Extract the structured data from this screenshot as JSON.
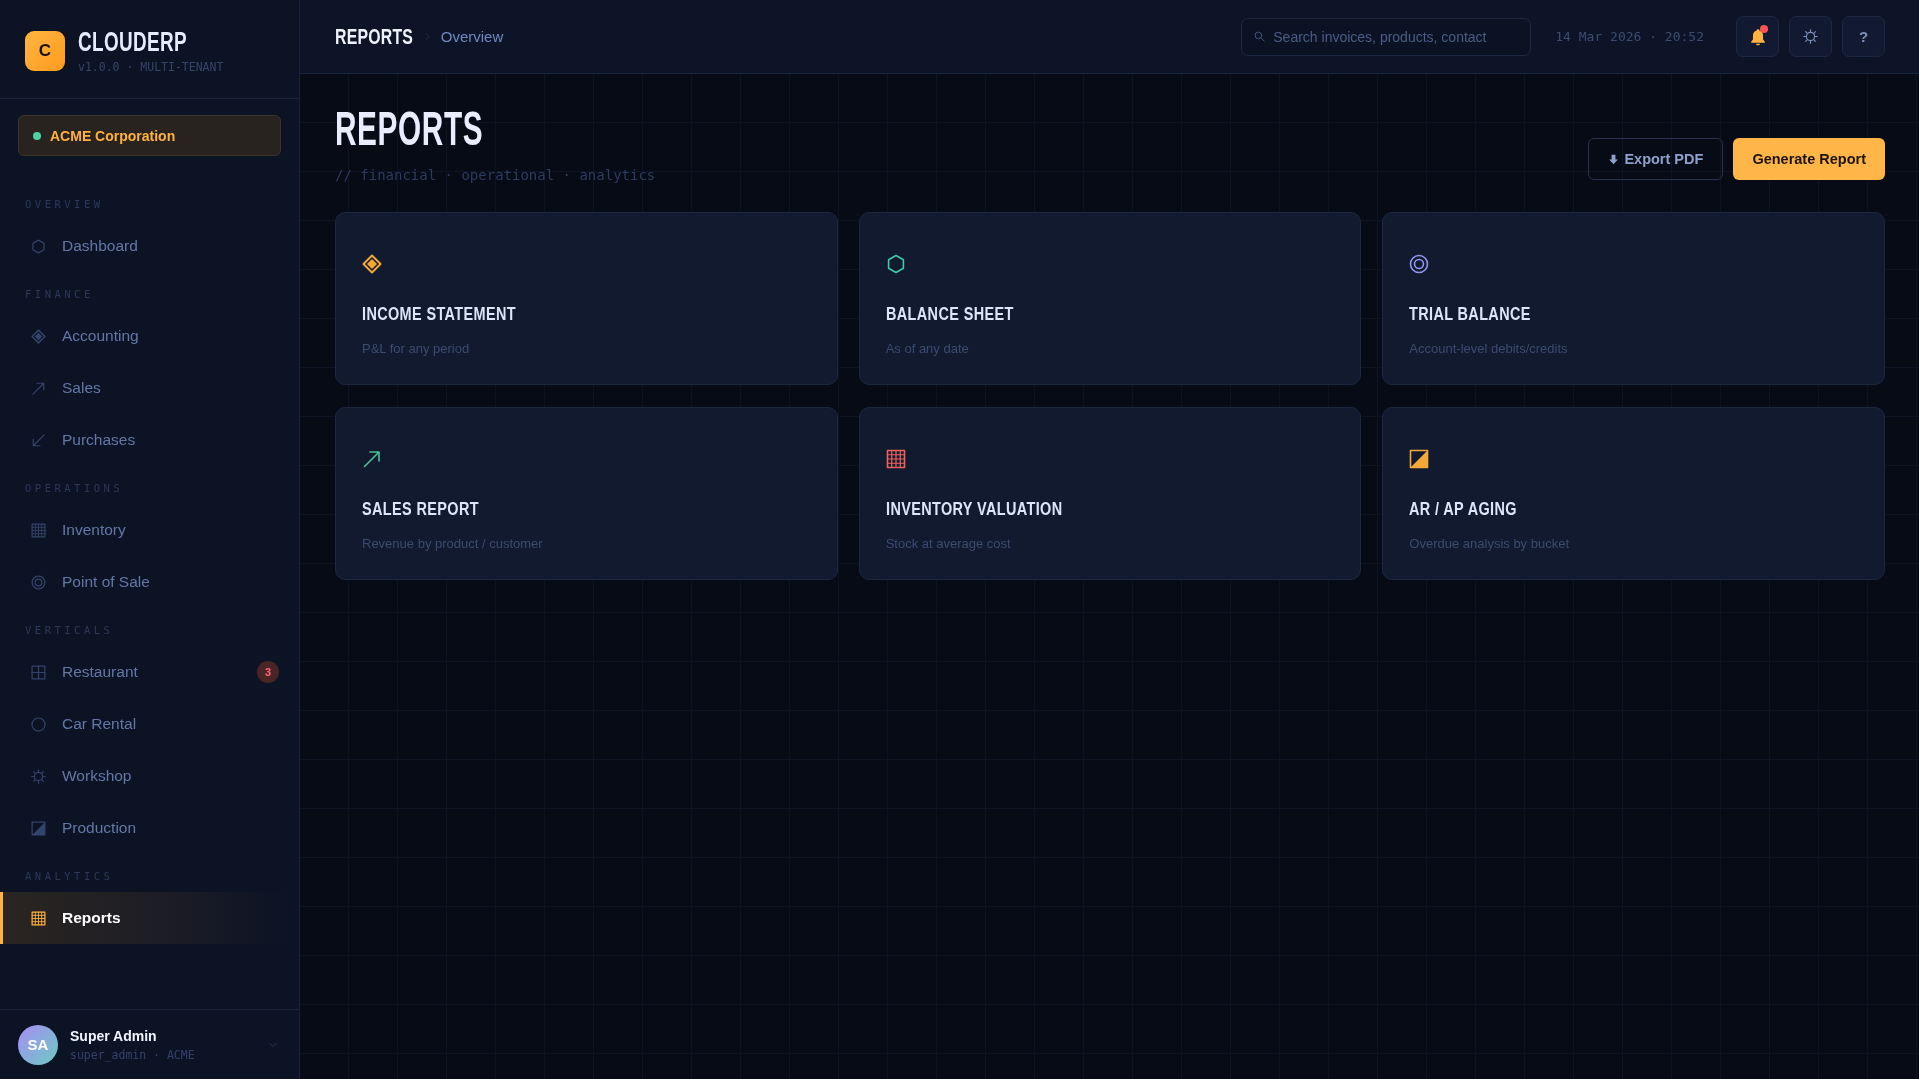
{
  "sidebar": {
    "brand": {
      "logo": "C",
      "name": "CLOUDERP",
      "version": "v1.0.0 · MULTI-TENANT"
    },
    "tenant": {
      "name": "ACME Corporation"
    },
    "sections": [
      {
        "label": "OVERVIEW",
        "items": [
          {
            "label": "Dashboard",
            "selected": false
          }
        ]
      },
      {
        "label": "FINANCE",
        "items": [
          {
            "label": "Accounting",
            "selected": false
          },
          {
            "label": "Sales",
            "selected": false
          },
          {
            "label": "Purchases",
            "selected": false
          }
        ]
      },
      {
        "label": "OPERATIONS",
        "items": [
          {
            "label": "Inventory",
            "selected": false
          },
          {
            "label": "Point of Sale",
            "selected": false
          }
        ]
      },
      {
        "label": "VERTICALS",
        "items": [
          {
            "label": "Restaurant",
            "selected": false,
            "badge": "3"
          },
          {
            "label": "Car Rental",
            "selected": false
          },
          {
            "label": "Workshop",
            "selected": false
          },
          {
            "label": "Production",
            "selected": false
          }
        ]
      },
      {
        "label": "ANALYTICS",
        "items": [
          {
            "label": "Reports",
            "selected": true
          }
        ]
      }
    ],
    "user": {
      "initials": "SA",
      "name": "Super Admin",
      "handle": "super_admin · ACME"
    }
  },
  "topbar": {
    "breadcrumb": [
      {
        "label": "REPORTS"
      },
      {
        "label": "Overview"
      }
    ],
    "search": {
      "placeholder": "Search invoices, products, contact"
    },
    "datetime": "14 Mar 2026 · 20:52",
    "notifications": {
      "unread": true
    },
    "help": "?"
  },
  "page": {
    "title": "REPORTS",
    "subtitle": "// financial · operational · analytics",
    "actions": [
      {
        "label": "Export PDF",
        "kind": "secondary"
      },
      {
        "label": "Generate Report",
        "kind": "primary"
      }
    ],
    "cards": [
      {
        "title": "INCOME STATEMENT",
        "description": "P&L for any period",
        "color": "#f5a83a"
      },
      {
        "title": "BALANCE SHEET",
        "description": "As of any date",
        "color": "#44c7a6"
      },
      {
        "title": "TRIAL BALANCE",
        "description": "Account-level debits/credits",
        "color": "#9297f0"
      },
      {
        "title": "SALES REPORT",
        "description": "Revenue by product / customer",
        "color": "#44c295"
      },
      {
        "title": "INVENTORY VALUATION",
        "description": "Stock at average cost",
        "color": "#f2625c"
      },
      {
        "title": "AR / AP AGING",
        "description": "Overdue analysis by bucket",
        "color": "#f5a83a"
      }
    ]
  }
}
